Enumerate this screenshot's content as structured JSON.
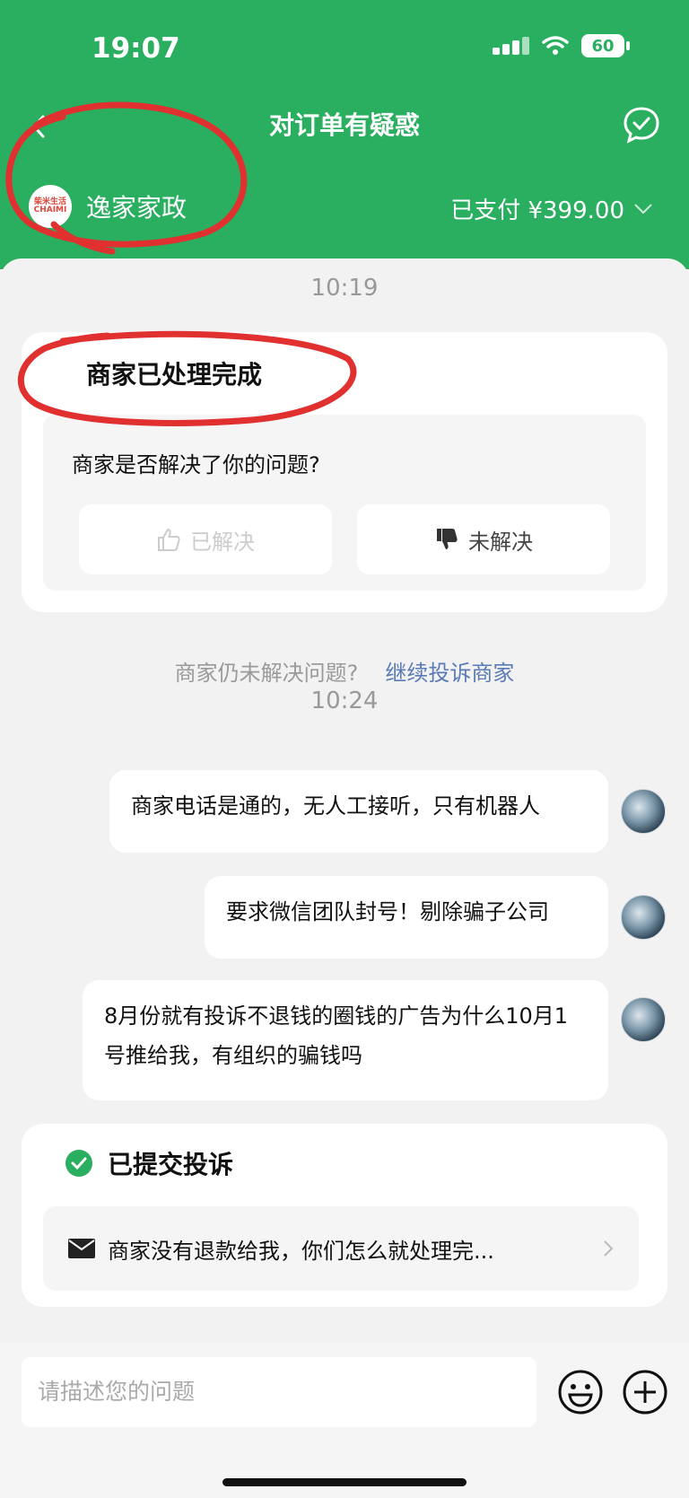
{
  "status_bar": {
    "time": "19:07",
    "battery": "60"
  },
  "nav": {
    "title": "对订单有疑惑"
  },
  "merchant": {
    "name": "逸家家政",
    "logo_text": "柴米生活 CHAIMI",
    "payment": "已支付 ¥399.00"
  },
  "timeline": [
    {
      "time": "10:19"
    },
    {
      "time": "10:24"
    }
  ],
  "resolution_card": {
    "title": "商家已处理完成",
    "question": "商家是否解决了你的问题?",
    "resolved_label": "已解决",
    "unresolved_label": "未解决"
  },
  "followup": {
    "question": "商家仍未解决问题?",
    "link": "继续投诉商家"
  },
  "messages": [
    {
      "text": "商家电话是通的，无人工接听，只有机器人"
    },
    {
      "text": "要求微信团队封号！剔除骗子公司"
    },
    {
      "text": "8月份就有投诉不退钱的圈钱的广告为什么10月1号推给我，有组织的骗钱吗"
    }
  ],
  "complaint_card": {
    "title": "已提交投诉",
    "summary": "商家没有退款给我，你们怎么就处理完..."
  },
  "input": {
    "placeholder": "请描述您的问题"
  },
  "colors": {
    "brand_green": "#2aae5f",
    "link_blue": "#5a7bb5",
    "annotation_red": "#e0302f"
  },
  "icons": [
    "back-icon",
    "chat-check-icon",
    "chevron-down-icon",
    "thumbs-up-icon",
    "thumbs-down-icon",
    "check-circle-icon",
    "mail-icon",
    "chevron-right-icon",
    "emoji-icon",
    "plus-icon"
  ]
}
